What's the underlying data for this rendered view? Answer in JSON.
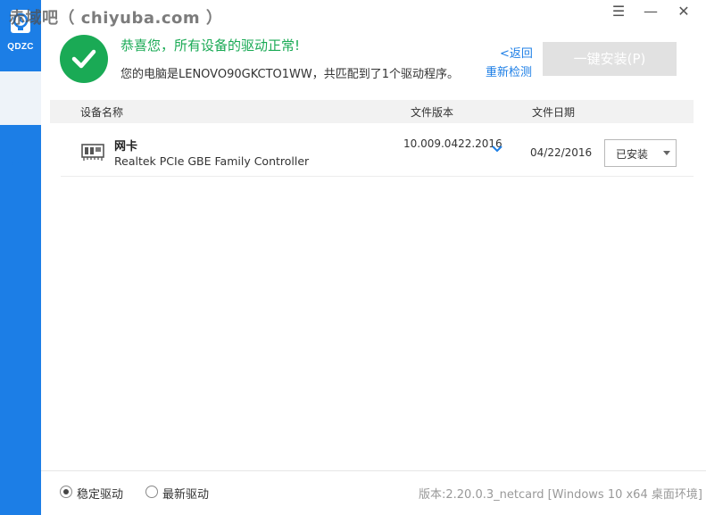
{
  "watermark": "赤域吧（ chiyuba.com ）",
  "sidebar": {
    "logo_text": "QDZC",
    "items": [
      {
        "icon": "gear-icon"
      }
    ]
  },
  "window_controls": {
    "menu_glyph": "☰",
    "minimize_glyph": "—",
    "close_glyph": "✕"
  },
  "header": {
    "title": "恭喜您，所有设备的驱动正常!",
    "subtitle": "您的电脑是LENOVO90GKCTO1WW，共匹配到了1个驱动程序。",
    "back_label": "<返回",
    "rescan_label": "重新检测",
    "install_button": "一键安装(P)",
    "success_color": "#1aaa55",
    "accent_color": "#1c7ee6"
  },
  "table": {
    "columns": [
      "设备名称",
      "文件版本",
      "文件日期"
    ],
    "rows": [
      {
        "icon": "network-card-icon",
        "type": "网卡",
        "name": "Realtek PCIe GBE Family Controller",
        "version": "10.009.0422.2016",
        "date": "04/22/2016",
        "status": "已安装"
      }
    ]
  },
  "footer": {
    "radio_stable": "稳定驱动",
    "radio_latest": "最新驱动",
    "selected": "stable",
    "version_info": "版本:2.20.0.3_netcard [Windows 10 x64 桌面环境]"
  }
}
